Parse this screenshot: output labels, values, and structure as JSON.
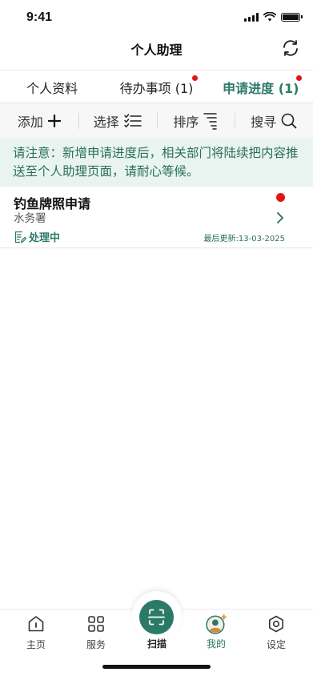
{
  "status_bar": {
    "time": "9:41"
  },
  "header": {
    "title": "个人助理",
    "refresh_icon": "refresh-icon"
  },
  "tabs": [
    {
      "label": "个人资料",
      "active": false,
      "has_dot": false
    },
    {
      "label": "待办事项 (1)",
      "active": false,
      "has_dot": true
    },
    {
      "label": "申请进度 (1)",
      "active": true,
      "has_dot": true
    }
  ],
  "toolbar": {
    "add_label": "添加",
    "select_label": "选择",
    "sort_label": "排序",
    "search_label": "搜寻"
  },
  "notice": {
    "text": "请注意：新增申请进度后，相关部门将陆续把内容推送至个人助理页面，请耐心等候。"
  },
  "applications": [
    {
      "name": "钓鱼牌照申请",
      "department": "水务署",
      "status": "处理中",
      "updated": "最后更新:13-03-2025",
      "unread": true
    }
  ],
  "bottom_nav": {
    "home": "主页",
    "services": "服务",
    "scan": "扫描",
    "mine": "我的",
    "settings": "设定"
  },
  "colors": {
    "accent": "#2b7a67",
    "badge": "#e0141b",
    "notice_bg": "#e9f4f0"
  }
}
